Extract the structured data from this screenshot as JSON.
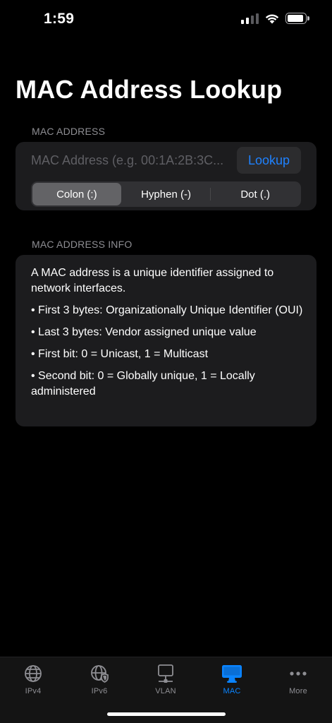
{
  "status_bar": {
    "time": "1:59",
    "battery_level": 0.9
  },
  "page": {
    "title": "MAC Address Lookup"
  },
  "mac_section": {
    "header": "MAC ADDRESS",
    "input_placeholder": "MAC Address (e.g. 00:1A:2B:3C...",
    "input_value": "",
    "lookup_label": "Lookup",
    "accent_color": "#1f82ff",
    "format_options": [
      "Colon (:)",
      "Hyphen (-)",
      "Dot (.)"
    ],
    "selected_format": "Colon (:)"
  },
  "info_section": {
    "header": "MAC ADDRESS INFO",
    "paragraphs": [
      "A MAC address is a unique identifier assigned to network interfaces.",
      "• First 3 bytes: Organizationally Unique Identifier (OUI)",
      "• Last 3 bytes: Vendor assigned unique value",
      "• First bit: 0 = Unicast, 1 = Multicast",
      "• Second bit: 0 = Globally unique, 1 = Locally administered"
    ]
  },
  "tab_bar": {
    "active_color": "#0a84ff",
    "tabs": [
      {
        "label": "IPv4",
        "icon": "globe-icon",
        "active": false
      },
      {
        "label": "IPv6",
        "icon": "globe-shield-icon",
        "active": false
      },
      {
        "label": "VLAN",
        "icon": "network-display-icon",
        "active": false
      },
      {
        "label": "MAC",
        "icon": "desktop-computer-icon",
        "active": true
      },
      {
        "label": "More",
        "icon": "ellipsis-icon",
        "active": false
      }
    ]
  }
}
